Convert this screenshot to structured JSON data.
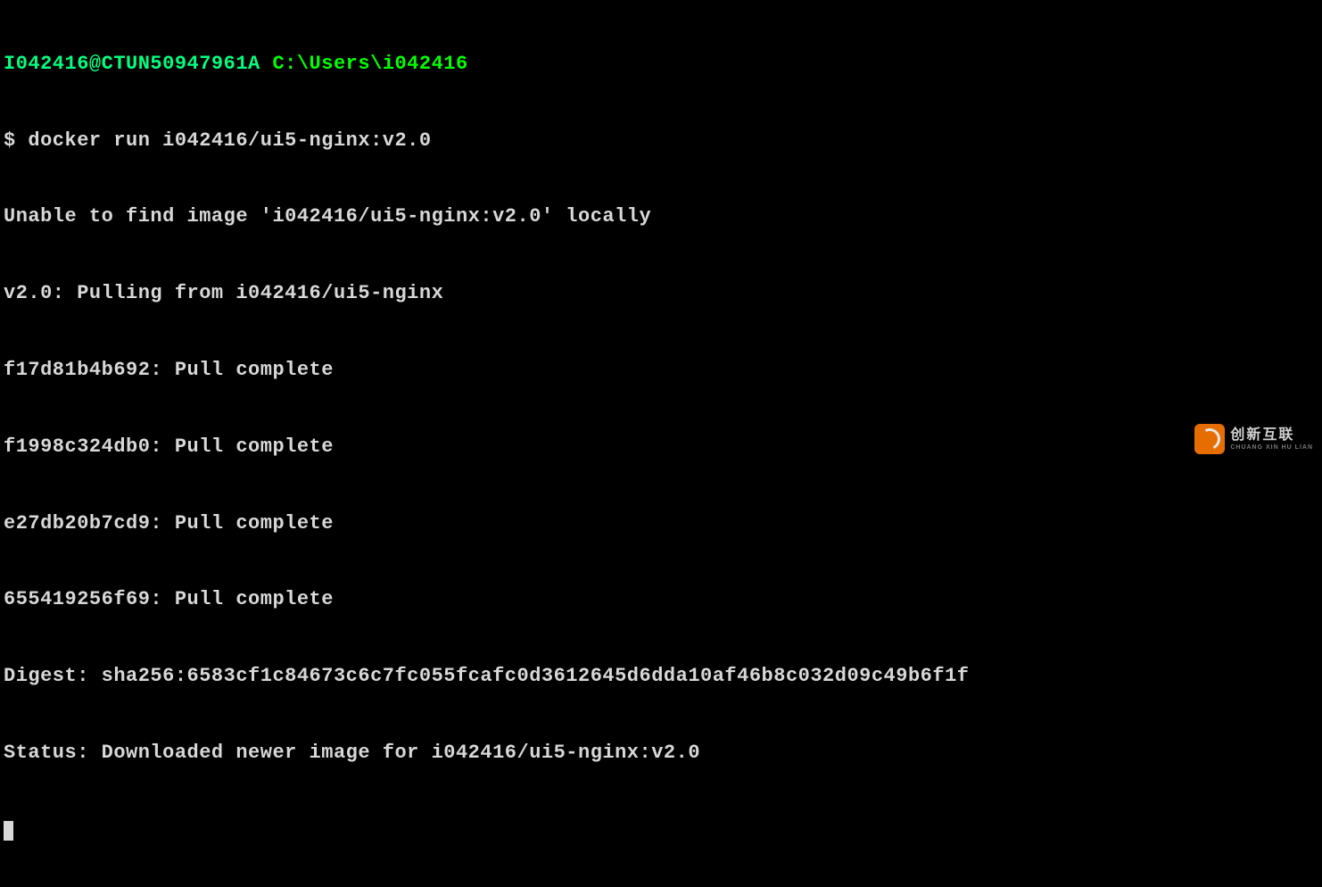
{
  "prompt": {
    "user_host": "I042416@CTUN50947961A",
    "path": "C:\\Users\\i042416",
    "symbol": "$",
    "command": "docker run i042416/ui5-nginx:v2.0"
  },
  "output": {
    "line1": "Unable to find image 'i042416/ui5-nginx:v2.0' locally",
    "line2": "v2.0: Pulling from i042416/ui5-nginx",
    "line3": "f17d81b4b692: Pull complete",
    "line4": "f1998c324db0: Pull complete",
    "line5": "e27db20b7cd9: Pull complete",
    "line6": "655419256f69: Pull complete",
    "line7": "Digest: sha256:6583cf1c84673c6c7fc055fcafc0d3612645d6dda10af46b8c032d09c49b6f1f",
    "line8": "Status: Downloaded newer image for i042416/ui5-nginx:v2.0"
  },
  "watermark": {
    "main": "创新互联",
    "sub": "CHUANG XIN HU LIAN"
  }
}
